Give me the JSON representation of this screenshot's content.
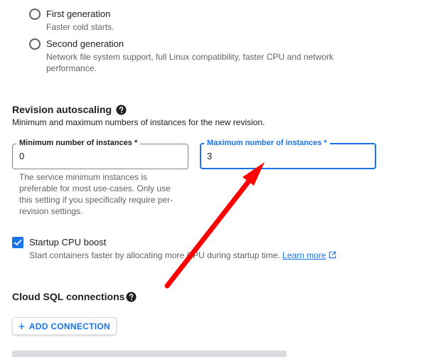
{
  "generation": {
    "options": [
      {
        "label": "First generation",
        "description": "Faster cold starts."
      },
      {
        "label": "Second generation",
        "description": "Network file system support, full Linux compatibility, faster CPU and network performance."
      }
    ]
  },
  "autoscaling": {
    "title": "Revision autoscaling",
    "help_icon": "help-circle-icon",
    "description": "Minimum and maximum numbers of instances for the new revision.",
    "min_field": {
      "label": "Minimum number of instances *",
      "value": "0",
      "helper": "The service minimum instances is preferable for most use-cases. Only use this setting if you specifically require per-revision settings."
    },
    "max_field": {
      "label": "Maximum number of instances *",
      "value": "3"
    }
  },
  "startup_boost": {
    "checked": true,
    "label": "Startup CPU boost",
    "description": "Start containers faster by allocating more CPU during startup time.",
    "link_label": "Learn more",
    "link_icon": "open-in-new-icon"
  },
  "cloud_sql": {
    "title": "Cloud SQL connections",
    "help_icon": "help-circle-icon",
    "add_button_label": "ADD CONNECTION",
    "add_button_icon": "plus-icon"
  },
  "annotation": {
    "type": "arrow",
    "color": "#ff0000"
  },
  "colors": {
    "accent": "#1a73e8",
    "text": "#202124",
    "muted": "#5f6368",
    "annotation": "#ff0000"
  }
}
